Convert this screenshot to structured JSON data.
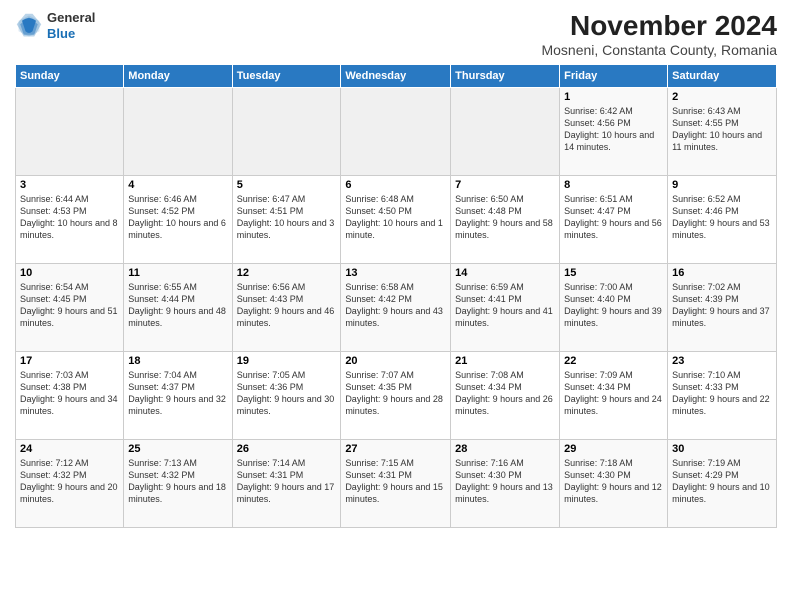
{
  "header": {
    "logo_line1": "General",
    "logo_line2": "Blue",
    "month_title": "November 2024",
    "subtitle": "Mosneni, Constanta County, Romania"
  },
  "days_of_week": [
    "Sunday",
    "Monday",
    "Tuesday",
    "Wednesday",
    "Thursday",
    "Friday",
    "Saturday"
  ],
  "weeks": [
    [
      {
        "day": "",
        "info": ""
      },
      {
        "day": "",
        "info": ""
      },
      {
        "day": "",
        "info": ""
      },
      {
        "day": "",
        "info": ""
      },
      {
        "day": "",
        "info": ""
      },
      {
        "day": "1",
        "info": "Sunrise: 6:42 AM\nSunset: 4:56 PM\nDaylight: 10 hours and 14 minutes."
      },
      {
        "day": "2",
        "info": "Sunrise: 6:43 AM\nSunset: 4:55 PM\nDaylight: 10 hours and 11 minutes."
      }
    ],
    [
      {
        "day": "3",
        "info": "Sunrise: 6:44 AM\nSunset: 4:53 PM\nDaylight: 10 hours and 8 minutes."
      },
      {
        "day": "4",
        "info": "Sunrise: 6:46 AM\nSunset: 4:52 PM\nDaylight: 10 hours and 6 minutes."
      },
      {
        "day": "5",
        "info": "Sunrise: 6:47 AM\nSunset: 4:51 PM\nDaylight: 10 hours and 3 minutes."
      },
      {
        "day": "6",
        "info": "Sunrise: 6:48 AM\nSunset: 4:50 PM\nDaylight: 10 hours and 1 minute."
      },
      {
        "day": "7",
        "info": "Sunrise: 6:50 AM\nSunset: 4:48 PM\nDaylight: 9 hours and 58 minutes."
      },
      {
        "day": "8",
        "info": "Sunrise: 6:51 AM\nSunset: 4:47 PM\nDaylight: 9 hours and 56 minutes."
      },
      {
        "day": "9",
        "info": "Sunrise: 6:52 AM\nSunset: 4:46 PM\nDaylight: 9 hours and 53 minutes."
      }
    ],
    [
      {
        "day": "10",
        "info": "Sunrise: 6:54 AM\nSunset: 4:45 PM\nDaylight: 9 hours and 51 minutes."
      },
      {
        "day": "11",
        "info": "Sunrise: 6:55 AM\nSunset: 4:44 PM\nDaylight: 9 hours and 48 minutes."
      },
      {
        "day": "12",
        "info": "Sunrise: 6:56 AM\nSunset: 4:43 PM\nDaylight: 9 hours and 46 minutes."
      },
      {
        "day": "13",
        "info": "Sunrise: 6:58 AM\nSunset: 4:42 PM\nDaylight: 9 hours and 43 minutes."
      },
      {
        "day": "14",
        "info": "Sunrise: 6:59 AM\nSunset: 4:41 PM\nDaylight: 9 hours and 41 minutes."
      },
      {
        "day": "15",
        "info": "Sunrise: 7:00 AM\nSunset: 4:40 PM\nDaylight: 9 hours and 39 minutes."
      },
      {
        "day": "16",
        "info": "Sunrise: 7:02 AM\nSunset: 4:39 PM\nDaylight: 9 hours and 37 minutes."
      }
    ],
    [
      {
        "day": "17",
        "info": "Sunrise: 7:03 AM\nSunset: 4:38 PM\nDaylight: 9 hours and 34 minutes."
      },
      {
        "day": "18",
        "info": "Sunrise: 7:04 AM\nSunset: 4:37 PM\nDaylight: 9 hours and 32 minutes."
      },
      {
        "day": "19",
        "info": "Sunrise: 7:05 AM\nSunset: 4:36 PM\nDaylight: 9 hours and 30 minutes."
      },
      {
        "day": "20",
        "info": "Sunrise: 7:07 AM\nSunset: 4:35 PM\nDaylight: 9 hours and 28 minutes."
      },
      {
        "day": "21",
        "info": "Sunrise: 7:08 AM\nSunset: 4:34 PM\nDaylight: 9 hours and 26 minutes."
      },
      {
        "day": "22",
        "info": "Sunrise: 7:09 AM\nSunset: 4:34 PM\nDaylight: 9 hours and 24 minutes."
      },
      {
        "day": "23",
        "info": "Sunrise: 7:10 AM\nSunset: 4:33 PM\nDaylight: 9 hours and 22 minutes."
      }
    ],
    [
      {
        "day": "24",
        "info": "Sunrise: 7:12 AM\nSunset: 4:32 PM\nDaylight: 9 hours and 20 minutes."
      },
      {
        "day": "25",
        "info": "Sunrise: 7:13 AM\nSunset: 4:32 PM\nDaylight: 9 hours and 18 minutes."
      },
      {
        "day": "26",
        "info": "Sunrise: 7:14 AM\nSunset: 4:31 PM\nDaylight: 9 hours and 17 minutes."
      },
      {
        "day": "27",
        "info": "Sunrise: 7:15 AM\nSunset: 4:31 PM\nDaylight: 9 hours and 15 minutes."
      },
      {
        "day": "28",
        "info": "Sunrise: 7:16 AM\nSunset: 4:30 PM\nDaylight: 9 hours and 13 minutes."
      },
      {
        "day": "29",
        "info": "Sunrise: 7:18 AM\nSunset: 4:30 PM\nDaylight: 9 hours and 12 minutes."
      },
      {
        "day": "30",
        "info": "Sunrise: 7:19 AM\nSunset: 4:29 PM\nDaylight: 9 hours and 10 minutes."
      }
    ]
  ]
}
